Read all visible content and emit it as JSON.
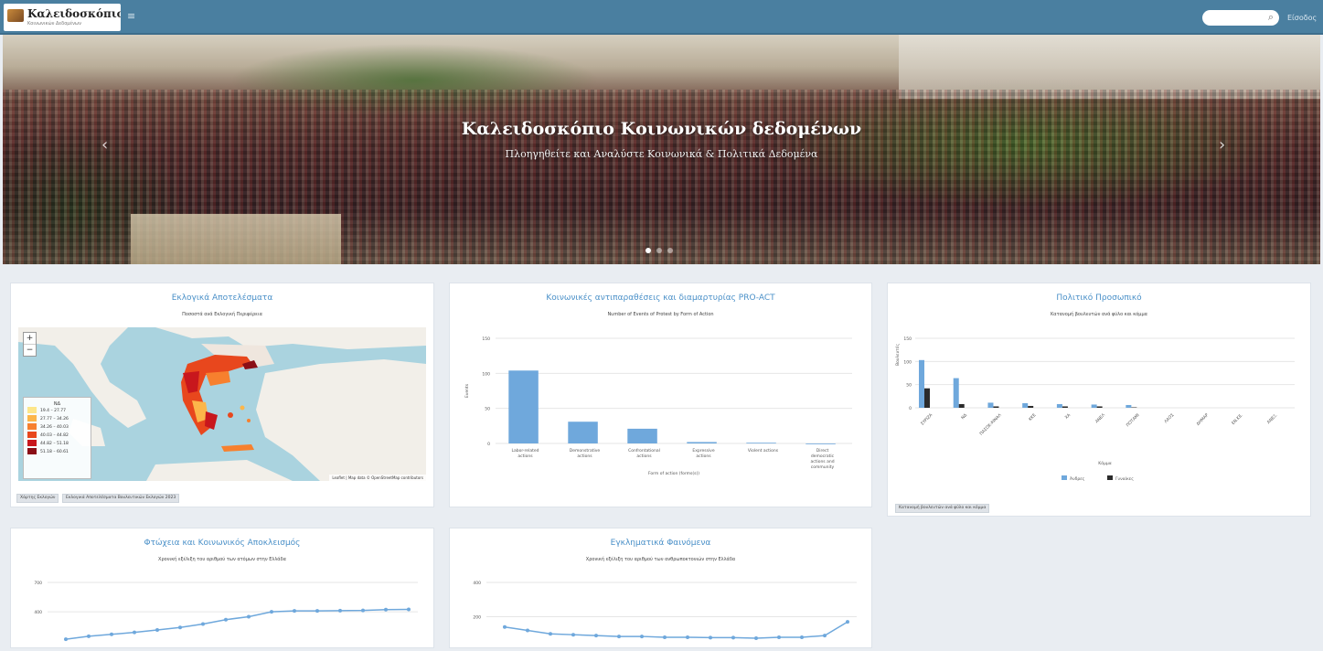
{
  "header": {
    "logo_title": "Καλειδοσκόπιο",
    "logo_subtitle": "Κοινωνικών Δεδομένων",
    "login_label": "Είσοδος"
  },
  "hero": {
    "title": "Καλειδοσκόπιο Κοινωνικών δεδομένων",
    "subtitle": "Πλοηγηθείτε και Αναλύστε Κοινωνικά & Πολιτικά Δεδομένα",
    "slides": 3,
    "active_slide": 1
  },
  "cards": {
    "elections": {
      "title": "Εκλογικά Αποτελέσματα",
      "subtitle": "Ποσοστά ανά Εκλογική Περιφέρεια",
      "legend_title": "ΝΔ",
      "legend": [
        {
          "label": "19.4 – 27.77",
          "color": "#fde68a"
        },
        {
          "label": "27.77 – 34.26",
          "color": "#fcb64a"
        },
        {
          "label": "34.26 – 40.03",
          "color": "#f7802e"
        },
        {
          "label": "40.03 – 44.82",
          "color": "#e8471d"
        },
        {
          "label": "44.82 – 51.18",
          "color": "#c8171d"
        },
        {
          "label": "51.18 – 60.61",
          "color": "#8b0f16"
        }
      ],
      "attribution": "Leaflet | Map data © OpenStreetMap contributors",
      "tags": [
        "Χάρτης Εκλογών",
        "Εκλογικά Αποτελέσματα Βουλευτικών Εκλογών 2023"
      ]
    },
    "protests": {
      "title": "Κοινωνικές αντιπαραθέσεις και διαμαρτυρίας PRO-ACT",
      "subtitle": "Number of Events of Protest by Form of Action"
    },
    "politics": {
      "title": "Πολιτικό Προσωπικό",
      "subtitle": "Κατανομή βουλευτών ανά φύλο και κόμμα",
      "tag": "Κατανομή βουλευτών ανά φύλο και κόμμα"
    },
    "poverty": {
      "title": "Φτώχεια και Κοινωνικός Αποκλεισμός",
      "subtitle": "Χρονική εξέλιξη του αριθμού των ατόμων στην Ελλάδα"
    },
    "crime": {
      "title": "Εγκληματικά Φαινόμενα",
      "subtitle": "Χρονική εξέλιξη του αριθμού των ανθρωποκτονιών στην Ελλάδα"
    }
  },
  "chart_data": [
    {
      "type": "bar",
      "categories": [
        "Labor-related actions",
        "Demonstrative actions",
        "Confrontational actions",
        "Expressive actions",
        "Violent actions",
        "Direct democratic actions and community"
      ],
      "values": [
        104,
        31,
        21,
        2,
        1,
        0
      ],
      "xlabel": "Form of action (forms(s))",
      "ylabel": "Events",
      "ylim": [
        0,
        150
      ],
      "yticks": [
        "0",
        "50",
        "100",
        "150"
      ],
      "color": "#6fa8dc"
    },
    {
      "type": "bar",
      "categories": [
        "ΣΥΡΙΖΑ",
        "ΝΔ",
        "ΠΑΣΟΚ-ΚΙΝΑΛ",
        "ΚΚΕ",
        "ΧΑ",
        "ΑΝΕΛ",
        "ΠΟΤΑΜΙ",
        "ΛΑΟΣ",
        "ΔΗΜΑΡ",
        "ΕΝ.ΚΕ.",
        "ΑΝΕΞ."
      ],
      "series": [
        {
          "name": "Άνδρες",
          "values": [
            103,
            64,
            11,
            10,
            8,
            7,
            6,
            0,
            0,
            0,
            0
          ],
          "color": "#6fa8dc"
        },
        {
          "name": "Γυναίκες",
          "values": [
            42,
            8,
            3,
            4,
            3,
            3,
            1,
            0,
            0,
            0,
            0
          ],
          "color": "#2b2b2b"
        }
      ],
      "xlabel": "Κόμμα",
      "ylabel": "Βουλευτές",
      "ylim": [
        0,
        150
      ],
      "yticks": [
        "0",
        "50",
        "100",
        "150"
      ]
    },
    {
      "type": "line",
      "x": [
        1,
        2,
        3,
        4,
        5,
        6,
        7,
        8,
        9,
        10,
        11,
        12,
        13,
        14,
        15,
        16
      ],
      "values": [
        120,
        150,
        170,
        190,
        215,
        240,
        275,
        320,
        350,
        400,
        410,
        410,
        412,
        414,
        422,
        425
      ],
      "yticks": [
        "700",
        "400"
      ],
      "ylim": [
        0,
        700
      ],
      "color": "#6fa8dc"
    },
    {
      "type": "line",
      "x": [
        1,
        2,
        3,
        4,
        5,
        6,
        7,
        8,
        9,
        10,
        11,
        12,
        13,
        14,
        15,
        16
      ],
      "values": [
        140,
        120,
        100,
        95,
        90,
        85,
        85,
        80,
        80,
        78,
        78,
        75,
        80,
        80,
        90,
        170
      ],
      "yticks": [
        "400",
        "200"
      ],
      "ylim": [
        0,
        400
      ],
      "color": "#6fa8dc"
    }
  ]
}
